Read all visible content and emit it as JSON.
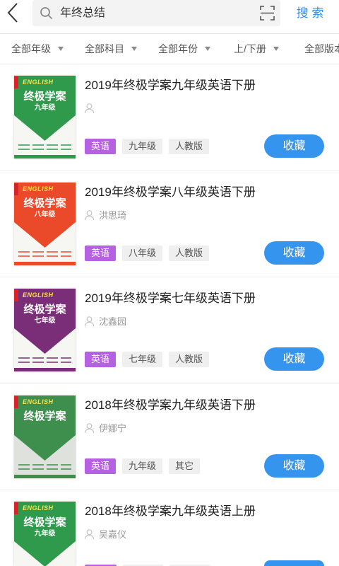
{
  "header": {
    "back_icon": "chevron-left-icon",
    "search_icon": "search-icon",
    "search_value": "年终总结",
    "scan_icon": "scan-icon",
    "search_button": "搜 索"
  },
  "filters": [
    {
      "label": "全部年级",
      "icon": "caret-down-icon"
    },
    {
      "label": "全部科目",
      "icon": "caret-down-icon"
    },
    {
      "label": "全部年份",
      "icon": "caret-down-icon"
    },
    {
      "label": "上/下册",
      "icon": "caret-down-icon"
    },
    {
      "label": "全部版本"
    }
  ],
  "colors": {
    "accent": "#2d8ff0",
    "subject_tag": "#b660e2",
    "neutral_tag": "#efefef",
    "collect_button": "#3594ee"
  },
  "author_icon": "person-icon",
  "books": [
    {
      "title": "2019年终极学案九年级英语下册",
      "author": "",
      "subject": "英语",
      "grade": "九年级",
      "edition": "人教版",
      "collect_label": "收藏",
      "cover": {
        "brand": "ENGLISH",
        "title": "终极学案",
        "grade": "九年级",
        "color": "#2f9a4b",
        "paper": "#f6f6f3"
      }
    },
    {
      "title": "2019年终极学案八年级英语下册",
      "author": "洪思琦",
      "subject": "英语",
      "grade": "八年级",
      "edition": "人教版",
      "collect_label": "收藏",
      "cover": {
        "brand": "ENGLISH",
        "title": "终极学案",
        "grade": "八年级",
        "color": "#ea4a2a",
        "paper": "#f6f6f3"
      }
    },
    {
      "title": "2019年终极学案七年级英语下册",
      "author": "沈鑫园",
      "subject": "英语",
      "grade": "七年级",
      "edition": "人教版",
      "collect_label": "收藏",
      "cover": {
        "brand": "ENGLISH",
        "title": "终极学案",
        "grade": "七年级",
        "color": "#7b2e78",
        "paper": "#f6f6f3"
      }
    },
    {
      "title": "2018年终极学案九年级英语下册",
      "author": "伊娜宁",
      "subject": "英语",
      "grade": "九年级",
      "edition": "其它",
      "collect_label": "收藏",
      "cover": {
        "brand": "ENGLISH",
        "title": "终极学案",
        "grade": "",
        "color": "#3e8e4d",
        "paper": "#dfe1dc"
      }
    },
    {
      "title": "2018年终极学案九年级英语上册",
      "author": "吴嘉仪",
      "cover": {
        "brand": "ENGLISH",
        "title": "终极学案",
        "grade": "九年级",
        "color": "#2f9a4b",
        "paper": "#f6f6f3"
      }
    }
  ]
}
